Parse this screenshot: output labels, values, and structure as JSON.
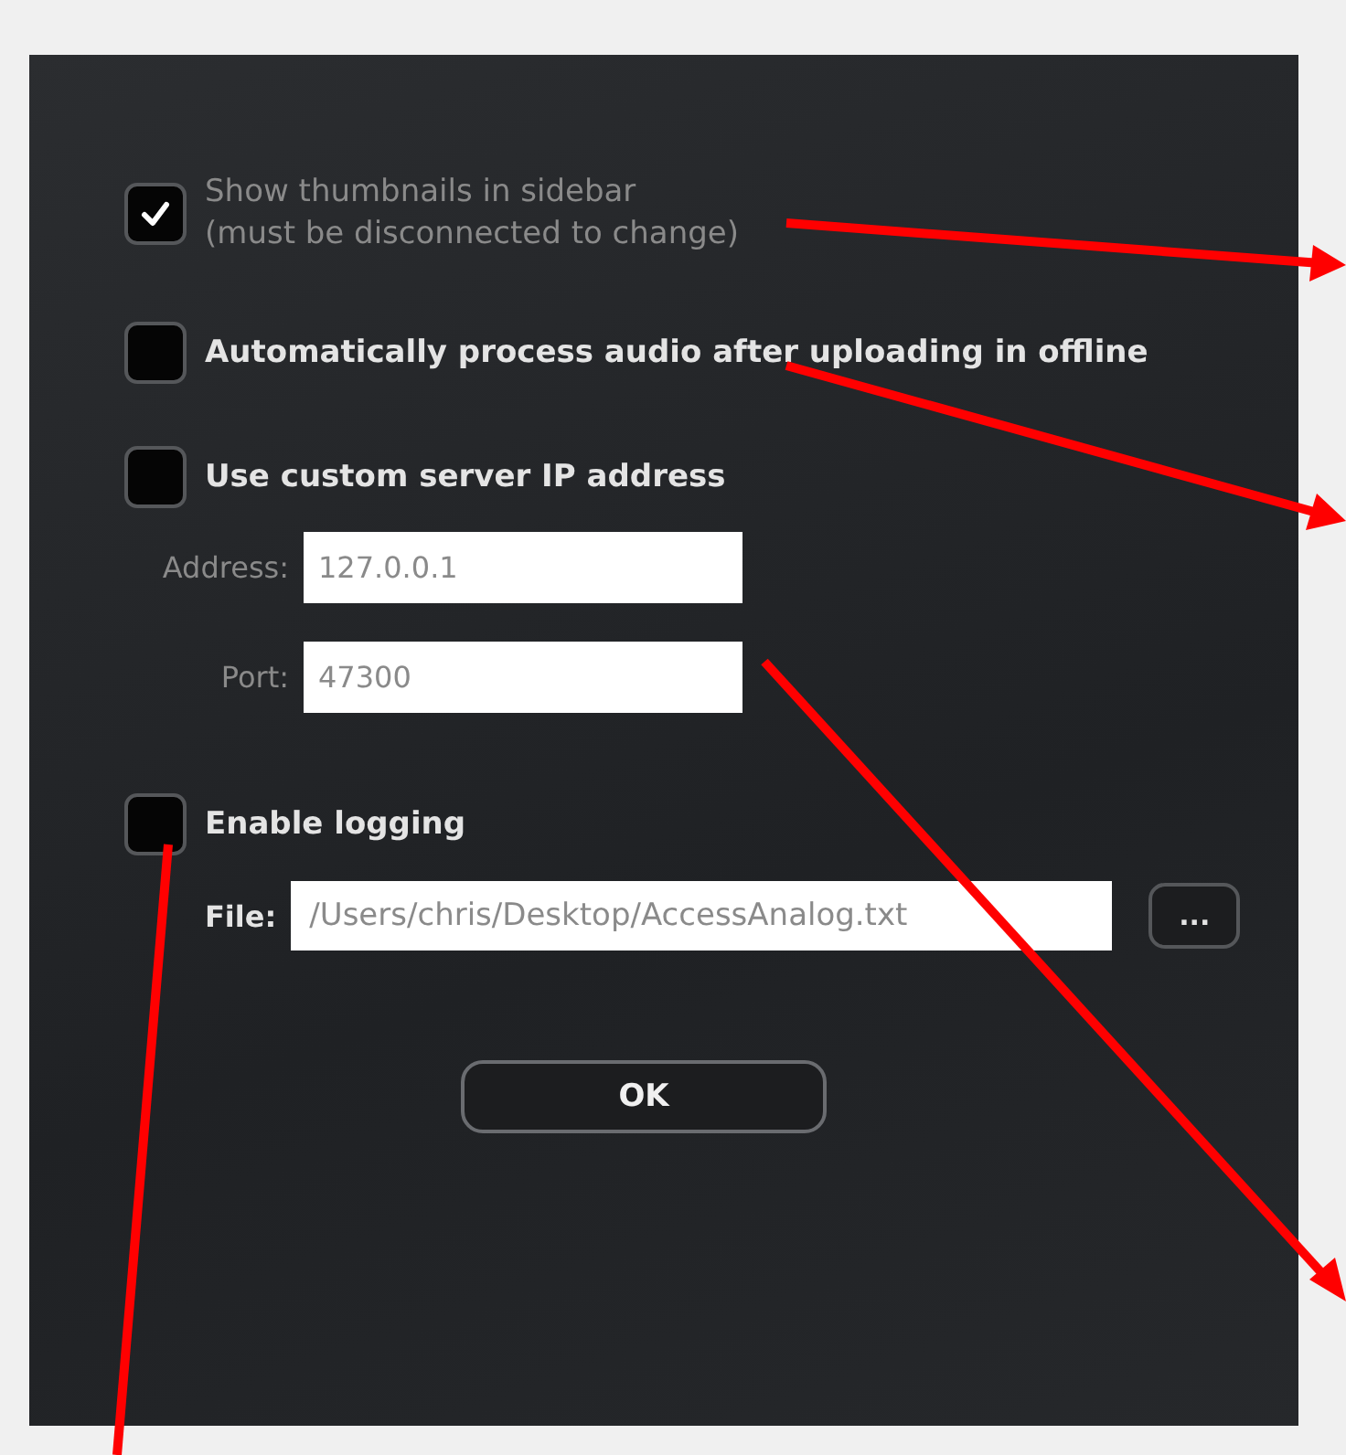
{
  "thumbnails": {
    "label": "Show thumbnails in sidebar",
    "note": "(must be disconnected to change)",
    "checked": true,
    "disabled": true
  },
  "auto_process": {
    "label": "Automatically process audio after uploading in offline",
    "checked": false,
    "disabled": false
  },
  "custom_server": {
    "label": "Use custom server IP address",
    "checked": false,
    "disabled": false,
    "fields": [
      {
        "label": "Address:",
        "value": "127.0.0.1"
      },
      {
        "label": "Port:",
        "value": "47300"
      }
    ]
  },
  "logging": {
    "label": "Enable logging",
    "checked": false,
    "disabled": false,
    "file": {
      "label": "File:",
      "value": "/Users/chris/Desktop/AccessAnalog.txt"
    },
    "browse_button": "..."
  },
  "ok_button": "OK"
}
